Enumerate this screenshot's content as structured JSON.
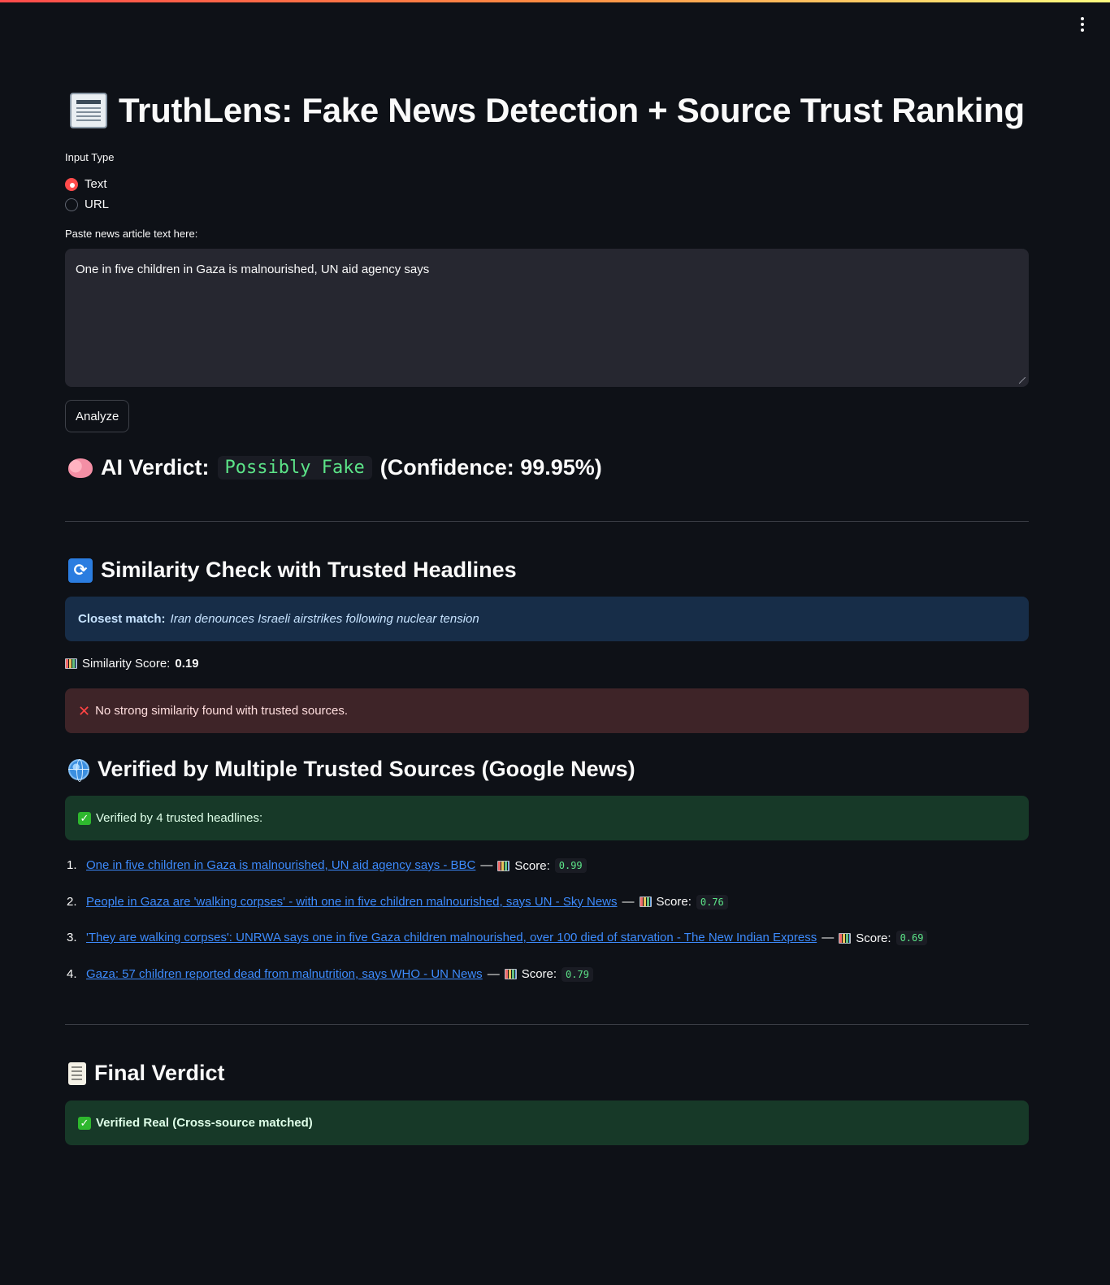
{
  "app": {
    "title": "TruthLens: Fake News Detection + Source Trust Ranking"
  },
  "input_type": {
    "label": "Input Type",
    "options": [
      "Text",
      "URL"
    ],
    "selected": "Text"
  },
  "article": {
    "label": "Paste news article text here:",
    "value": "One in five children in Gaza is malnourished, UN aid agency says"
  },
  "analyze_button": "Analyze",
  "ai_verdict": {
    "label": "AI Verdict:",
    "value": "Possibly Fake",
    "confidence": "(Confidence: 99.95%)"
  },
  "similarity": {
    "heading": "Similarity Check with Trusted Headlines",
    "closest_label": "Closest match:",
    "closest_value": "Iran denounces Israeli airstrikes following nuclear tension",
    "score_label": "Similarity Score:",
    "score_value": "0.19",
    "error_text": "No strong similarity found with trusted sources."
  },
  "verified": {
    "heading": "Verified by Multiple Trusted Sources (Google News)",
    "summary": "Verified by 4 trusted headlines:",
    "score_label": "Score:",
    "items": [
      {
        "num": "1.",
        "title": "One in five children in Gaza is malnourished, UN aid agency says - BBC",
        "score": "0.99"
      },
      {
        "num": "2.",
        "title": "People in Gaza are 'walking corpses' - with one in five children malnourished, says UN - Sky News",
        "score": "0.76"
      },
      {
        "num": "3.",
        "title": "'They are walking corpses': UNRWA says one in five Gaza children malnourished, over 100 died of starvation - The New Indian Express",
        "score": "0.69"
      },
      {
        "num": "4.",
        "title": "Gaza: 57 children reported dead from malnutrition, says WHO - UN News",
        "score": "0.79"
      }
    ]
  },
  "final": {
    "heading": "Final Verdict",
    "value": "Verified Real (Cross-source matched)"
  },
  "colors": {
    "background": "#0e1117",
    "accent": "#ff4b4b",
    "link": "#3d8bfd",
    "code": "#5ce488"
  }
}
